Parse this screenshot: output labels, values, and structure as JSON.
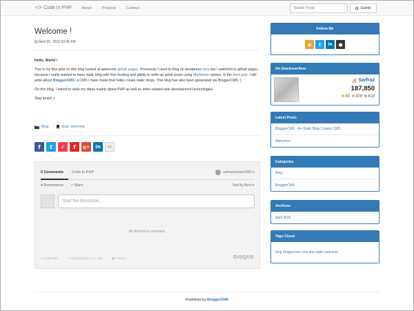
{
  "navbar": {
    "brand": "</> Code In PHP",
    "links": [
      "About",
      "Projects",
      "Contact"
    ],
    "search_placeholder": "Search Posts",
    "submit_label": "Submit"
  },
  "post": {
    "title": "Welcome !",
    "date": "April 05, 2015 03:46 PM",
    "hello": "Hello, World !",
    "p1_a": "This is my first post on this blog hosted at awesome ",
    "p1_link1": "github pages",
    "p1_b": ". Previously I used to blog on wordpress ",
    "p1_link2": "here",
    "p1_c": " but I switched to github pages because I really wanted to have static blog with free hosting and ability to write up quick posts using ",
    "p1_link3": "Markdown",
    "p1_d": " syntax. In the ",
    "p1_link4": "next post",
    "p1_e": ", I will write about ",
    "p1_link5": "BloggerCMS",
    "p1_f": ", a CMS I have made that helps create static blogs. This blog has also been generated via BloggerCMS :)",
    "p2": "On this blog, I intend to write my ideas mainly about PHP as well as other related web development technologies.",
    "p3": "Stay tuned :)",
    "category": "Blog",
    "tags": [
      "blog",
      "welcome"
    ]
  },
  "share": [
    {
      "name": "facebook-share-icon",
      "glyph": "f",
      "color": "#3b5998"
    },
    {
      "name": "twitter-share-icon",
      "glyph": "t",
      "color": "#1da1f2"
    },
    {
      "name": "pocket-share-icon",
      "glyph": "✓",
      "color": "#ee4056"
    },
    {
      "name": "flipboard-share-icon",
      "glyph": "f",
      "color": "#e12828"
    },
    {
      "name": "googleplus-share-icon",
      "glyph": "g+",
      "color": "#dd4b39"
    },
    {
      "name": "linkedin-share-icon",
      "glyph": "in",
      "color": "#0077b5"
    },
    {
      "name": "email-share-icon",
      "glyph": "✉",
      "color": "#c8c8c8"
    }
  ],
  "disqus": {
    "tab_comments": "0 Comments",
    "tab_site": "Code In PHP",
    "user": "sarfraznawaz2005 ▾",
    "recommend": "Recommend",
    "share": "Share",
    "sort": "Sort by Best ▾",
    "placeholder": "Start the discussion...",
    "first": "Be the first to comment.",
    "subscribe": "Subscribe",
    "add_disqus": "Add Disqus to your site",
    "privacy": "Privacy",
    "logo": "DISQUS"
  },
  "sidebar": {
    "follow_title": "Follow Me",
    "follow_icons": [
      {
        "name": "rss-icon",
        "glyph": "◉",
        "color": "#f0a030"
      },
      {
        "name": "twitter-icon",
        "glyph": "t",
        "color": "#1da1f2"
      },
      {
        "name": "linkedin-icon",
        "glyph": "in",
        "color": "#0077b5"
      },
      {
        "name": "github-icon",
        "glyph": "●",
        "color": "#333333"
      }
    ],
    "so_title": "On Stackoverflow",
    "so_name": "Sarfraz",
    "so_rep": "187,850",
    "so_gold": "43",
    "so_silver": "309",
    "so_bronze": "419",
    "latest_title": "Latest Posts",
    "latest": [
      "BloggerCMS - An Static Blog Creator CMS",
      "Welcome !"
    ],
    "categories_title": "Categories",
    "categories": [
      "Blog",
      "BloggerCMS"
    ],
    "archives_title": "Archives",
    "archives": [
      "April 2015"
    ],
    "tags_title": "Tags Cloud",
    "tags_cloud": "blog bloggercms cms php static welcome"
  },
  "footer": {
    "prefix": "Published by ",
    "link": "BloggerCMS"
  }
}
